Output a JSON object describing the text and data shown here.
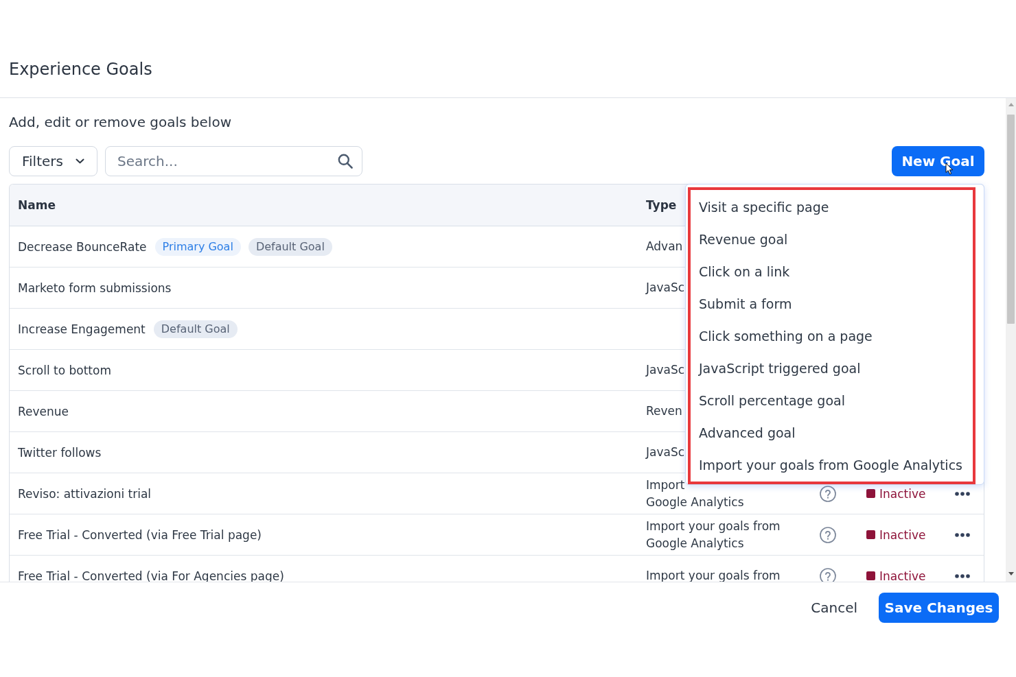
{
  "title": "Experience Goals",
  "subtitle": "Add, edit or remove goals below",
  "toolbar": {
    "filters": {
      "label": "Filters"
    },
    "search": {
      "placeholder": "Search..."
    },
    "new_goal": {
      "label": "New Goal"
    }
  },
  "table": {
    "columns": [
      "Name",
      "Type"
    ],
    "rows": [
      {
        "name": "Decrease BounceRate",
        "tags": [
          {
            "label": "Primary Goal",
            "kind": "primary"
          },
          {
            "label": "Default Goal",
            "kind": "default"
          }
        ],
        "type": [
          "Advan"
        ]
      },
      {
        "name": "Marketo form submissions",
        "type": [
          "JavaSc"
        ]
      },
      {
        "name": "Increase Engagement",
        "tags": [
          {
            "label": "Default Goal",
            "kind": "default"
          }
        ]
      },
      {
        "name": "Scroll to bottom",
        "type": [
          "JavaSc"
        ]
      },
      {
        "name": "Revenue",
        "type": [
          "Reven"
        ]
      },
      {
        "name": "Twitter follows",
        "type": [
          "JavaSc"
        ]
      },
      {
        "name": "Reviso: attivazioni trial",
        "type": [
          "Import",
          "Google Analytics"
        ],
        "status": {
          "kind": "inactive",
          "label": "Inactive"
        }
      },
      {
        "name": "Free Trial - Converted (via Free Trial page)",
        "type": [
          "Import your goals from",
          "Google Analytics"
        ],
        "status": {
          "kind": "inactive",
          "label": "Inactive"
        }
      },
      {
        "name": "Free Trial - Converted (via For Agencies page)",
        "type": [
          "Import your goals from"
        ],
        "status": {
          "kind": "inactive",
          "label": "Inactive"
        }
      }
    ]
  },
  "new_goal_menu": {
    "open": true,
    "items": [
      "Visit a specific page",
      "Revenue goal",
      "Click on a link",
      "Submit a form",
      "Click something on a page",
      "JavaScript triggered goal",
      "Scroll percentage goal",
      "Advanced goal",
      "Import your goals from Google Analytics"
    ]
  },
  "footer": {
    "buttons": [
      {
        "label": "Cancel",
        "kind": "secondary"
      },
      {
        "label": "Save Changes",
        "kind": "primary"
      }
    ]
  }
}
